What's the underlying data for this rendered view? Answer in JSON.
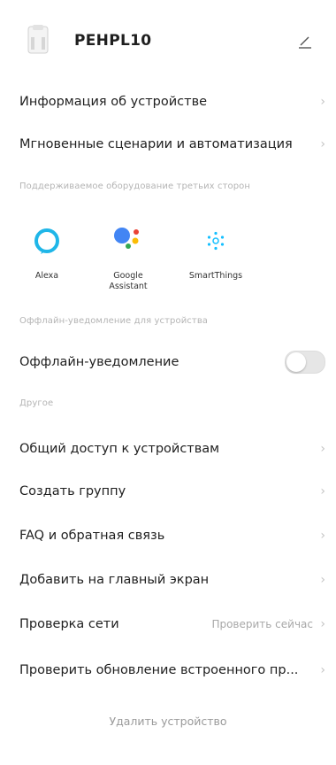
{
  "header": {
    "device_name": "PEHPL10"
  },
  "menu_top": [
    {
      "label": "Информация об устройстве"
    },
    {
      "label": "Мгновенные сценарии и автоматизация"
    }
  ],
  "third_party": {
    "section_title": "Поддерживаемое оборудование третьих сторон",
    "services": [
      {
        "name": "Alexa",
        "icon": "alexa-icon"
      },
      {
        "name": "Google\nAssistant",
        "icon": "google-assistant-icon"
      },
      {
        "name": "SmartThings",
        "icon": "smartthings-icon"
      }
    ]
  },
  "offline": {
    "section_title": "Оффлайн-уведомление для устройства",
    "label": "Оффлайн-уведомление",
    "enabled": false
  },
  "other": {
    "section_title": "Другое",
    "items": [
      {
        "label": "Общий доступ к устройствам"
      },
      {
        "label": "Создать группу"
      },
      {
        "label": "FAQ и обратная связь"
      },
      {
        "label": "Добавить на главный экран"
      },
      {
        "label": "Проверка сети",
        "value": "Проверить сейчас"
      },
      {
        "label": "Проверить обновление встроенного пр..."
      }
    ]
  },
  "delete_label": "Удалить устройство",
  "colors": {
    "alexa": "#1fb6e8",
    "google_blue": "#4285f4",
    "google_red": "#ea4335",
    "google_yellow": "#fbbc05",
    "google_green": "#34a853",
    "smartthings": "#15bfff"
  }
}
